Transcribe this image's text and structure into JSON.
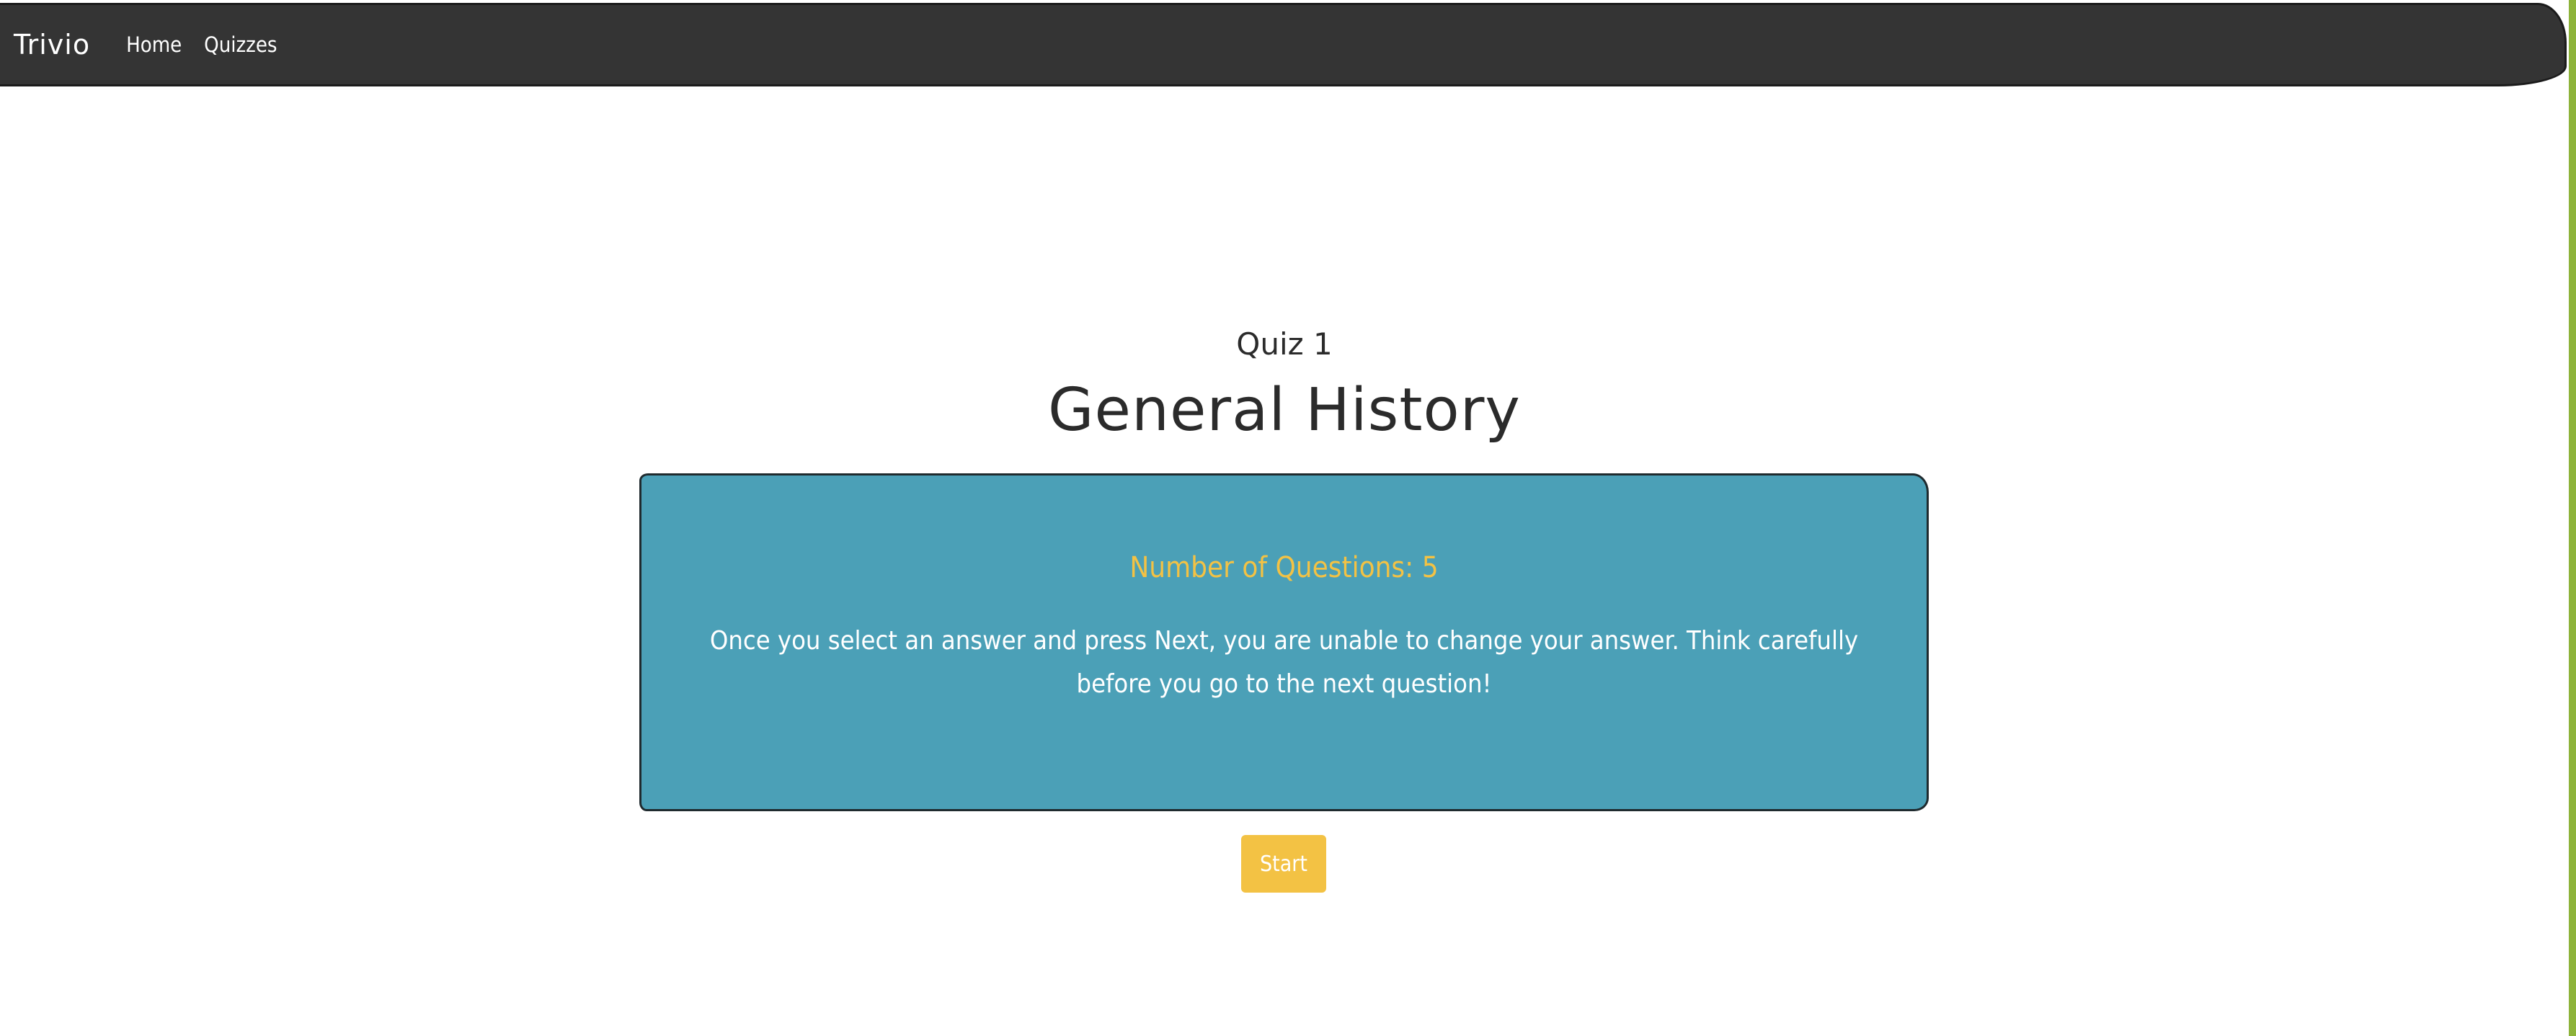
{
  "navbar": {
    "brand": "Trivio",
    "links": [
      {
        "label": "Home"
      },
      {
        "label": "Quizzes"
      }
    ]
  },
  "quiz": {
    "number_label": "Quiz 1",
    "title": "General History"
  },
  "info_card": {
    "question_count": "Number of Questions: 5",
    "instructions": "Once you select an answer and press Next, you are unable to change your answer. Think carefully before you go to the next question!"
  },
  "actions": {
    "start_label": "Start"
  },
  "colors": {
    "navbar_bg": "#343434",
    "card_bg": "#4ba0b7",
    "accent_yellow": "#f3c244",
    "right_accent_green": "#8db33a"
  }
}
